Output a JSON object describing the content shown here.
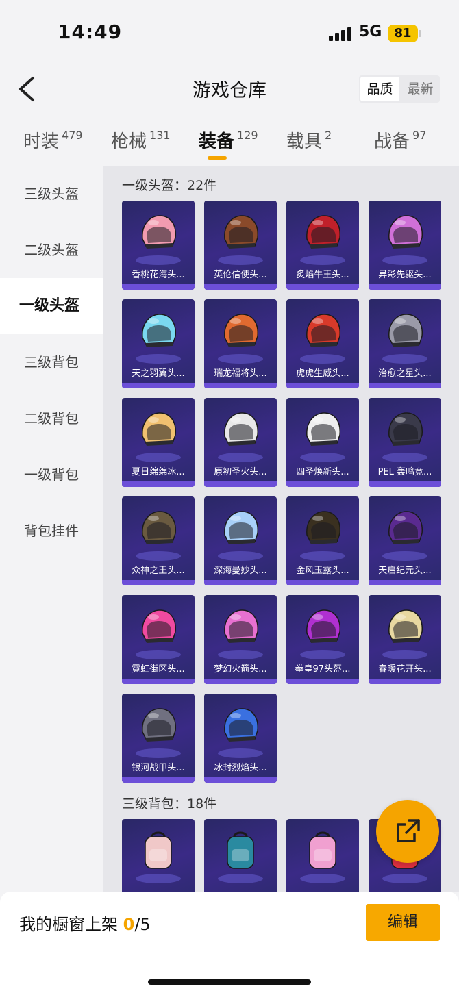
{
  "status_bar": {
    "time": "14:49",
    "network": "5G",
    "battery": "81"
  },
  "header": {
    "title": "游戏仓库",
    "sort_options": [
      "品质",
      "最新"
    ],
    "sort_selected": "品质"
  },
  "tabs": [
    {
      "label": "时装",
      "count": "479"
    },
    {
      "label": "枪械",
      "count": "131"
    },
    {
      "label": "装备",
      "count": "129",
      "active": true
    },
    {
      "label": "载具",
      "count": "2"
    },
    {
      "label": "战备",
      "count": "97"
    }
  ],
  "sidebar": {
    "items": [
      {
        "label": "三级头盔"
      },
      {
        "label": "二级头盔"
      },
      {
        "label": "一级头盔",
        "active": true
      },
      {
        "label": "三级背包"
      },
      {
        "label": "二级背包"
      },
      {
        "label": "一级背包"
      },
      {
        "label": "背包挂件"
      }
    ]
  },
  "sections": [
    {
      "title": "一级头盔：22件",
      "items": [
        {
          "name": "香桃花海头...",
          "color": "#f29bb0"
        },
        {
          "name": "英伦信使头...",
          "color": "#8a4a2a"
        },
        {
          "name": "炙焰牛王头...",
          "color": "#c0202a"
        },
        {
          "name": "异彩先驱头...",
          "color": "#d070d8"
        },
        {
          "name": "天之羽翼头...",
          "color": "#7ad8f0"
        },
        {
          "name": "瑞龙福将头...",
          "color": "#e06a30"
        },
        {
          "name": "虎虎生威头...",
          "color": "#d83a2a"
        },
        {
          "name": "治愈之星头...",
          "color": "#9a9aa8"
        },
        {
          "name": "夏日绵绵冰...",
          "color": "#f0c070"
        },
        {
          "name": "原初圣火头...",
          "color": "#e8e8e8"
        },
        {
          "name": "四圣焕新头...",
          "color": "#eeeeee"
        },
        {
          "name": "PEL 轰鸣竞...",
          "color": "#3a3a4a"
        },
        {
          "name": "众神之王头...",
          "color": "#6a5a40"
        },
        {
          "name": "深海曼妙头...",
          "color": "#a8d0f8"
        },
        {
          "name": "金风玉露头...",
          "color": "#3a3020"
        },
        {
          "name": "天启纪元头...",
          "color": "#5a2a90"
        },
        {
          "name": "霓虹街区头...",
          "color": "#f04aa0"
        },
        {
          "name": "梦幻火箭头...",
          "color": "#e870d0"
        },
        {
          "name": "拳皇97头盔...",
          "color": "#b030d0"
        },
        {
          "name": "春暖花开头...",
          "color": "#e8d8a0"
        },
        {
          "name": "银河战甲头...",
          "color": "#707080"
        },
        {
          "name": "冰封烈焰头...",
          "color": "#3a70e0"
        }
      ]
    },
    {
      "title": "三级背包：18件",
      "items": [
        {
          "name": "",
          "color": "#f0c8c8"
        },
        {
          "name": "",
          "color": "#2a8aa0"
        },
        {
          "name": "",
          "color": "#f0a0d0"
        },
        {
          "name": "",
          "color": "#e03040"
        }
      ]
    }
  ],
  "bottom_bar": {
    "showcase_label": "我的橱窗上架",
    "showcase_count": "0",
    "showcase_total": "/5",
    "edit_label": "编辑"
  }
}
